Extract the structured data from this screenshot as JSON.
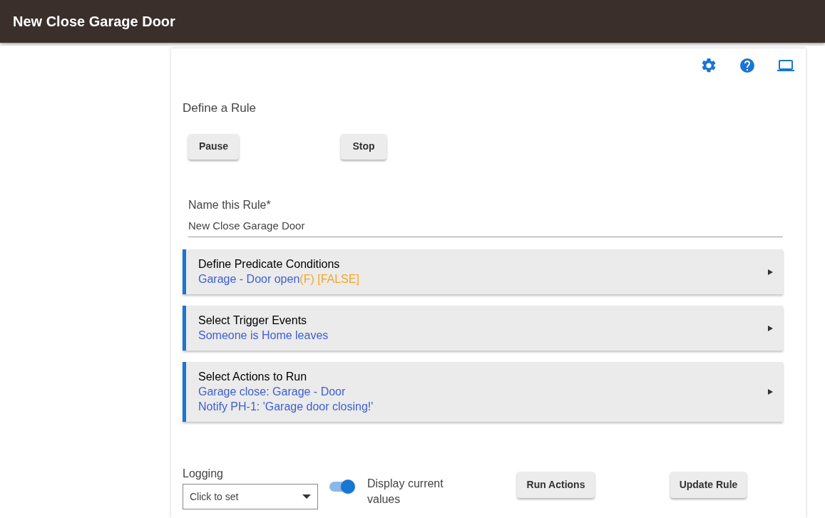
{
  "header": {
    "title": "New Close Garage Door"
  },
  "page": {
    "heading": "Define a Rule",
    "buttons": [
      "Pause",
      "Stop"
    ]
  },
  "name_field": {
    "label": "Name this Rule*",
    "value": "New Close Garage Door"
  },
  "sections": [
    {
      "title": "Define Predicate Conditions",
      "lines": [
        [
          {
            "text": "Garage - Door open",
            "color": "#3f5fcf"
          },
          {
            "text": "(F) [FALSE]",
            "color": "#f5a623"
          }
        ]
      ]
    },
    {
      "title": "Select Trigger Events",
      "lines": [
        [
          {
            "text": "Someone is Home leaves",
            "color": "#3f5fcf"
          }
        ]
      ]
    },
    {
      "title": "Select Actions to Run",
      "lines": [
        [
          {
            "text": "Garage close: Garage - Door",
            "color": "#3f5fcf"
          }
        ],
        [
          {
            "text": "Notify PH-1: 'Garage door closing!'",
            "color": "#3f5fcf"
          }
        ]
      ]
    }
  ],
  "logging": {
    "label": "Logging",
    "placeholder": "Click to set"
  },
  "display_toggle": {
    "label": "Display current values",
    "on": true
  },
  "actions": [
    "Run Actions",
    "Update Rule"
  ]
}
